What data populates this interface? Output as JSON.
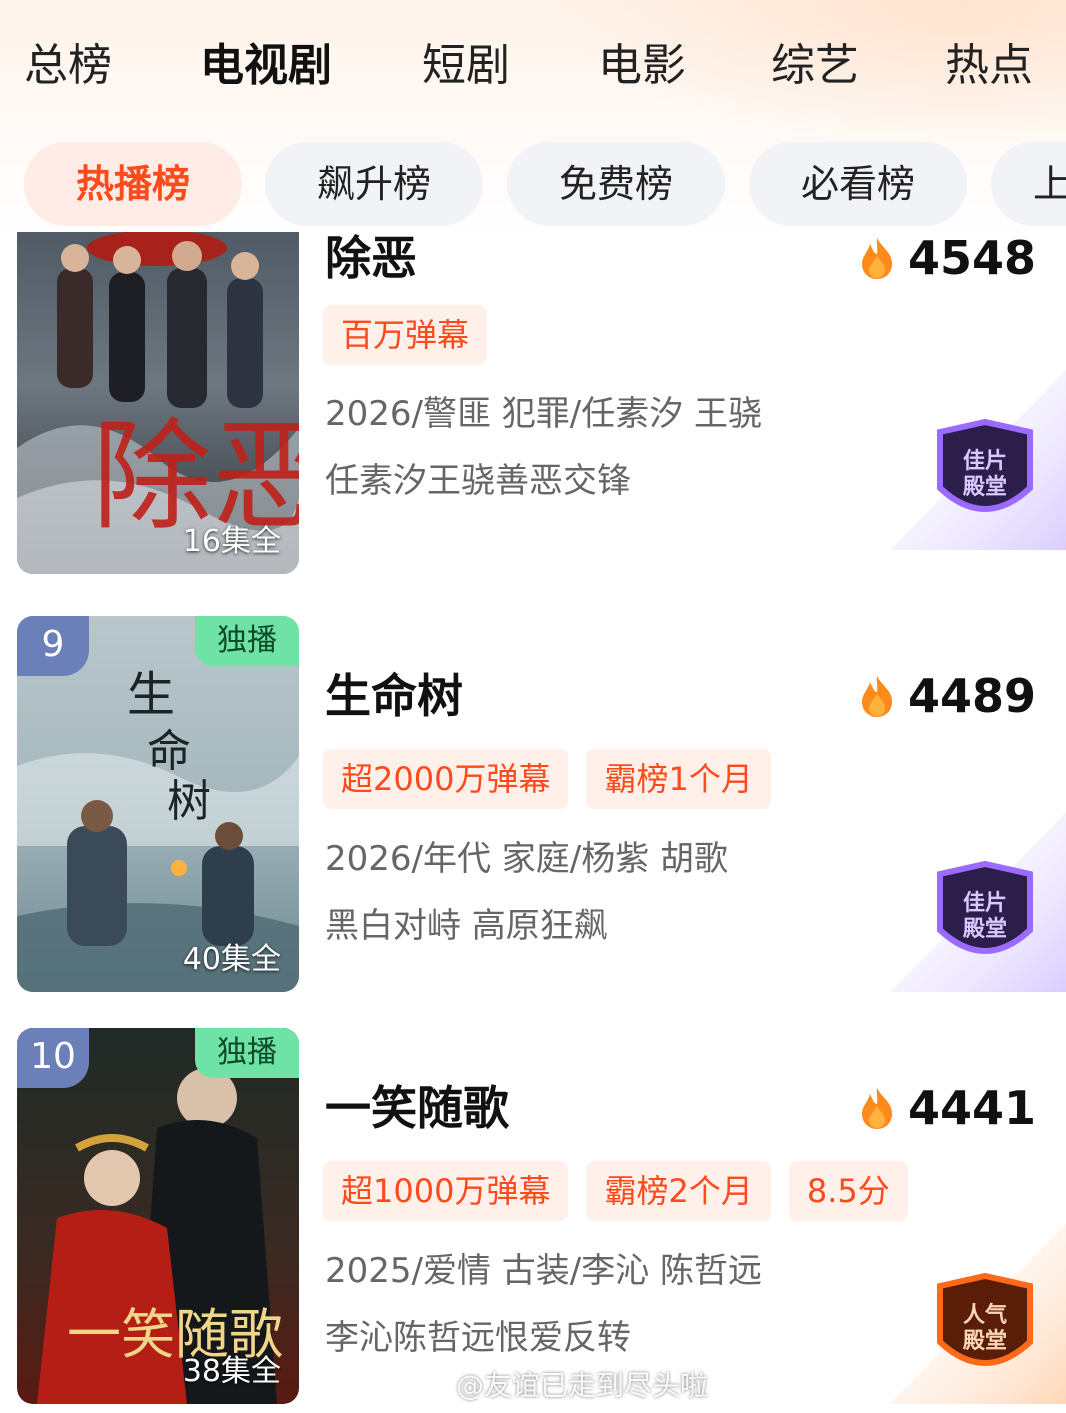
{
  "category_nav": {
    "items": [
      {
        "label": "总榜",
        "active": false
      },
      {
        "label": "电视剧",
        "active": true
      },
      {
        "label": "短剧",
        "active": false
      },
      {
        "label": "电影",
        "active": false
      },
      {
        "label": "综艺",
        "active": false
      },
      {
        "label": "热点",
        "active": false
      }
    ]
  },
  "sub_tabs": {
    "items": [
      {
        "label": "热播榜",
        "active": true
      },
      {
        "label": "飙升榜",
        "active": false
      },
      {
        "label": "免费榜",
        "active": false
      },
      {
        "label": "必看榜",
        "active": false
      },
      {
        "label": "上",
        "active": false
      }
    ]
  },
  "shows": [
    {
      "rank": "",
      "exclusive": "",
      "title": "除恶",
      "heat": "4548",
      "episodes": "16集全",
      "tags": [
        "百万弹幕"
      ],
      "meta": "2026/警匪 犯罪/任素汐 王骁",
      "desc": "任素汐王骁善恶交锋",
      "hall_badge": {
        "line1": "佳片",
        "line2": "殿堂",
        "color": "#7b3fe0"
      }
    },
    {
      "rank": "9",
      "exclusive": "独播",
      "title": "生命树",
      "heat": "4489",
      "episodes": "40集全",
      "tags": [
        "超2000万弹幕",
        "霸榜1个月"
      ],
      "meta": "2026/年代 家庭/杨紫 胡歌",
      "desc": "黑白对峙 高原狂飙",
      "hall_badge": {
        "line1": "佳片",
        "line2": "殿堂",
        "color": "#7b3fe0"
      }
    },
    {
      "rank": "10",
      "exclusive": "独播",
      "title": "一笑随歌",
      "heat": "4441",
      "episodes": "38集全",
      "tags": [
        "超1000万弹幕",
        "霸榜2个月",
        "8.5分"
      ],
      "meta": "2025/爱情 古装/李沁 陈哲远",
      "desc": "李沁陈哲远恨爱反转",
      "hall_badge": {
        "line1": "人气",
        "line2": "殿堂",
        "color": "#ff6a1a"
      }
    }
  ],
  "watermark": "@友谊已走到尽头啦",
  "colors": {
    "accent": "#ff4a1c",
    "tag_bg": "#fff0ea",
    "exclusive_green": "#6ee3a5",
    "rank_blue": "#6b7fb8"
  }
}
